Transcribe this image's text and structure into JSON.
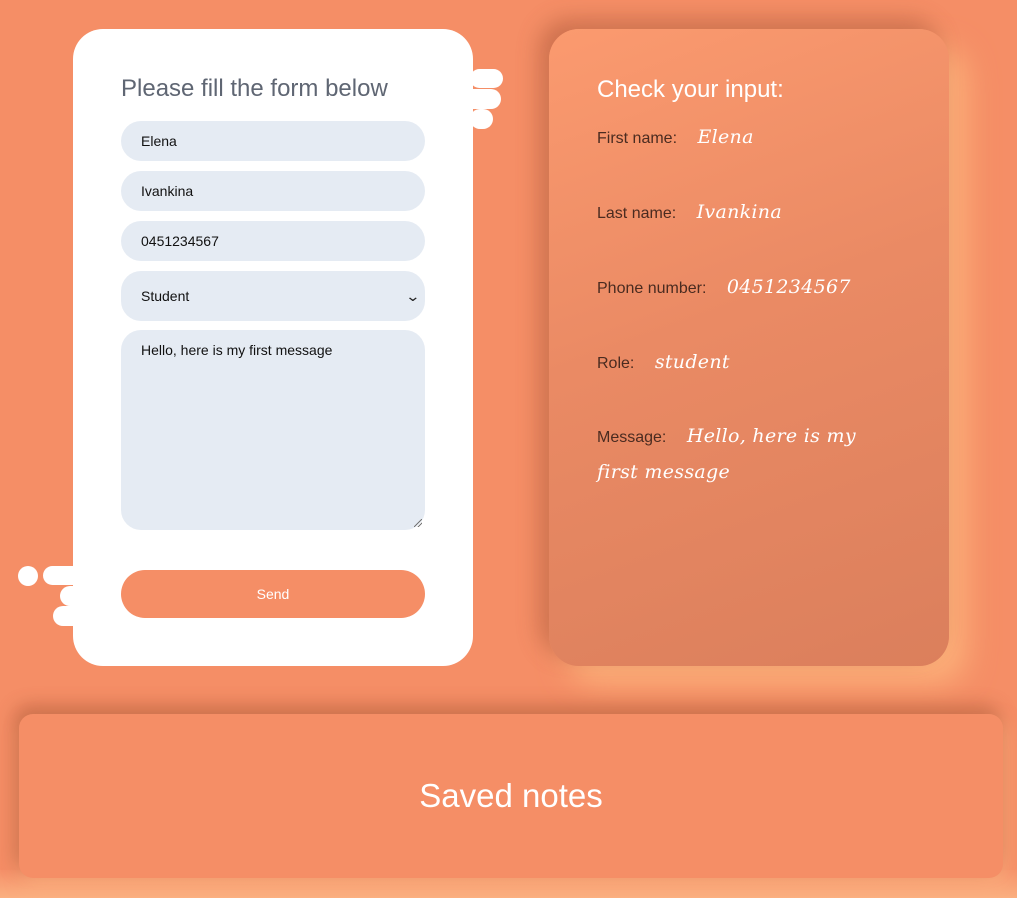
{
  "form": {
    "title": "Please fill the form below",
    "first_name": "Elena",
    "last_name": "Ivankina",
    "phone": "0451234567",
    "role": "Student",
    "message": "Hello, here is my first message",
    "send_label": "Send"
  },
  "preview": {
    "title": "Check your input:",
    "first_name_label": "First name:",
    "first_name_value": "Elena",
    "last_name_label": "Last name:",
    "last_name_value": "Ivankina",
    "phone_label": "Phone number:",
    "phone_value": "0451234567",
    "role_label": "Role:",
    "role_value": "student",
    "message_label": "Message:",
    "message_value": "Hello, here is my first message"
  },
  "saved": {
    "title": "Saved notes"
  },
  "colors": {
    "background": "#f58e66",
    "card": "#ffffff",
    "input": "#e5ebf3",
    "accent": "#f58e66"
  }
}
